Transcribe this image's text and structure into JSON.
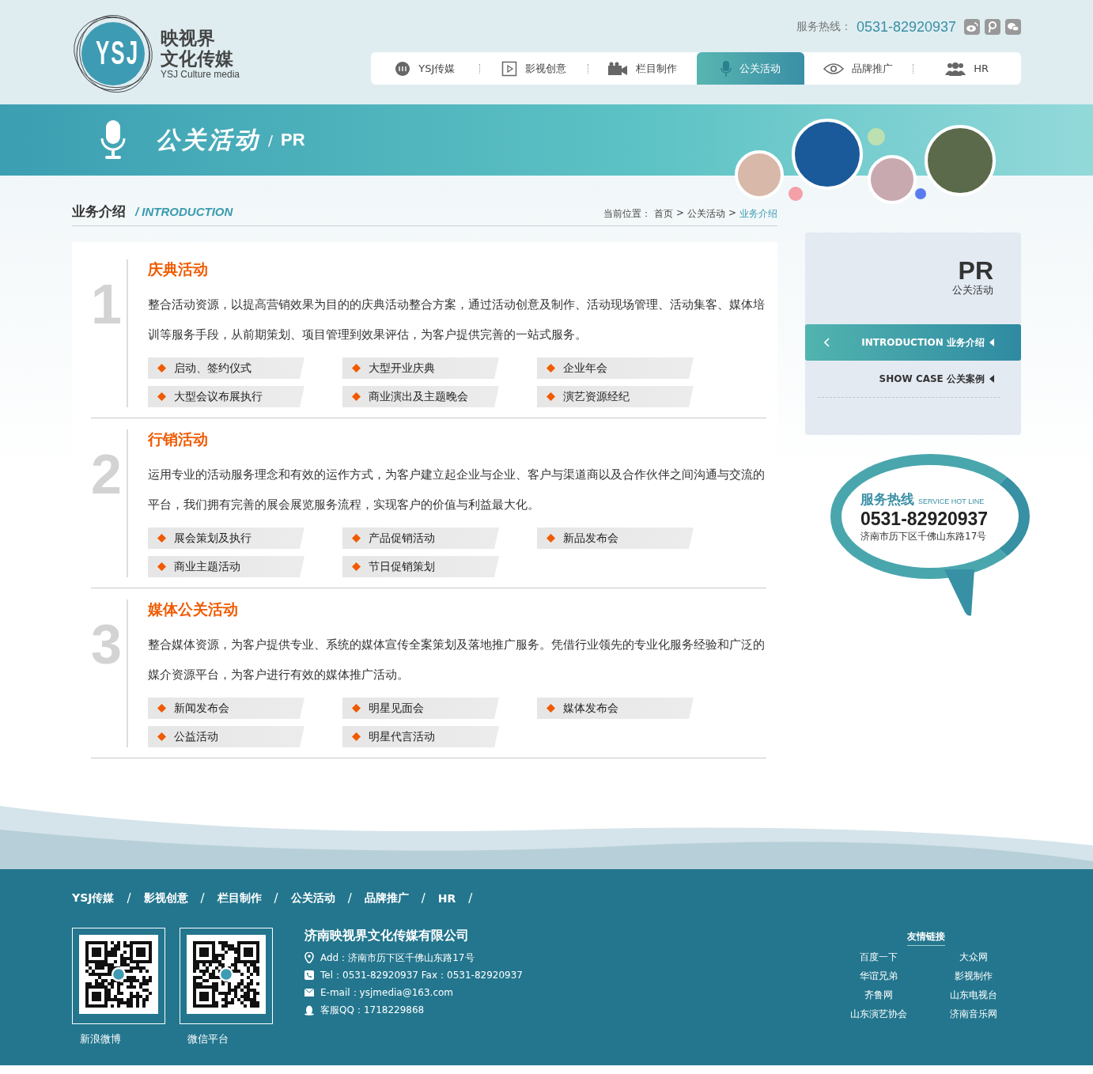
{
  "header": {
    "logo": {
      "mark": "YSJ",
      "name_lines": [
        "映视界",
        "文化传媒"
      ],
      "subtitle": "YSJ Culture media"
    },
    "hotline_label": "服务热线：",
    "hotline": "0531-82920937",
    "nav": [
      {
        "label": "YSJ传媒",
        "selected": false
      },
      {
        "label": "影视创意",
        "selected": false
      },
      {
        "label": "栏目制作",
        "selected": false
      },
      {
        "label": "公关活动",
        "selected": true
      },
      {
        "label": "品牌推广",
        "selected": false
      },
      {
        "label": "HR",
        "selected": false
      }
    ]
  },
  "banner": {
    "title": "公关活动",
    "separator": "/",
    "en": "PR"
  },
  "section": {
    "title": "业务介绍",
    "en": "/ INTRODUCTION",
    "breadcrumb_label": "当前位置：",
    "breadcrumb": [
      {
        "label": "首页",
        "current": false
      },
      {
        "label": "公关活动",
        "current": false
      },
      {
        "label": "业务介绍",
        "current": true
      }
    ],
    "breadcrumb_sep": ">"
  },
  "services": [
    {
      "number": "1",
      "title": "庆典活动",
      "text": "整合活动资源，以提高营销效果为目的的庆典活动整合方案，通过活动创意及制作、活动现场管理、活动集客、媒体培训等服务手段，从前期策划、项目管理到效果评估，为客户提供完善的一站式服务。",
      "tags": [
        "启动、签约仪式",
        "大型开业庆典",
        "企业年会",
        "大型会议布展执行",
        "商业演出及主题晚会",
        "演艺资源经纪"
      ]
    },
    {
      "number": "2",
      "title": "行销活动",
      "text": "运用专业的活动服务理念和有效的运作方式，为客户建立起企业与企业、客户与渠道商以及合作伙伴之间沟通与交流的平台，我们拥有完善的展会展览服务流程，实现客户的价值与利益最大化。",
      "tags": [
        "展会策划及执行",
        "产品促销活动",
        "新品发布会",
        "商业主题活动",
        "节日促销策划"
      ]
    },
    {
      "number": "3",
      "title": "媒体公关活动",
      "text": "整合媒体资源，为客户提供专业、系统的媒体宣传全案策划及落地推广服务。凭借行业领先的专业化服务经验和广泛的媒介资源平台，为客户进行有效的媒体推广活动。",
      "tags": [
        "新闻发布会",
        "明星见面会",
        "媒体发布会",
        "公益活动",
        "明星代言活动"
      ]
    }
  ],
  "sidebar": {
    "en": "PR",
    "cn": "公关活动",
    "menu": [
      {
        "label": "INTRODUCTION 业务介绍",
        "selected": true
      },
      {
        "label": "SHOW CASE 公关案例",
        "selected": false
      }
    ]
  },
  "hotline_card": {
    "title": "服务热线",
    "en": "SERVICE HOT LINE",
    "phone": "0531-82920937",
    "address": "济南市历下区千佛山东路17号"
  },
  "footer": {
    "nav": [
      "YSJ传媒",
      "影视创意",
      "栏目制作",
      "公关活动",
      "品牌推广",
      "HR"
    ],
    "nav_sep": "/",
    "qr_codes": [
      {
        "caption": "新浪微博"
      },
      {
        "caption": "微信平台"
      }
    ],
    "company": "济南映视界文化传媒有限公司",
    "contacts": [
      {
        "kind": "address",
        "text": "Add：济南市历下区千佛山东路17号"
      },
      {
        "kind": "phone",
        "text": "Tel：0531-82920937 Fax：0531-82920937"
      },
      {
        "kind": "mail",
        "text": "E-mail：ysjmedia@163.com"
      },
      {
        "kind": "qq",
        "text": "客服QQ：1718229868"
      }
    ],
    "links_title": "友情链接",
    "links": [
      "百度一下",
      "大众网",
      "华谊兄弟",
      "影视制作",
      "齐鲁网",
      "山东电视台",
      "山东演艺协会",
      "济南音乐网"
    ]
  }
}
